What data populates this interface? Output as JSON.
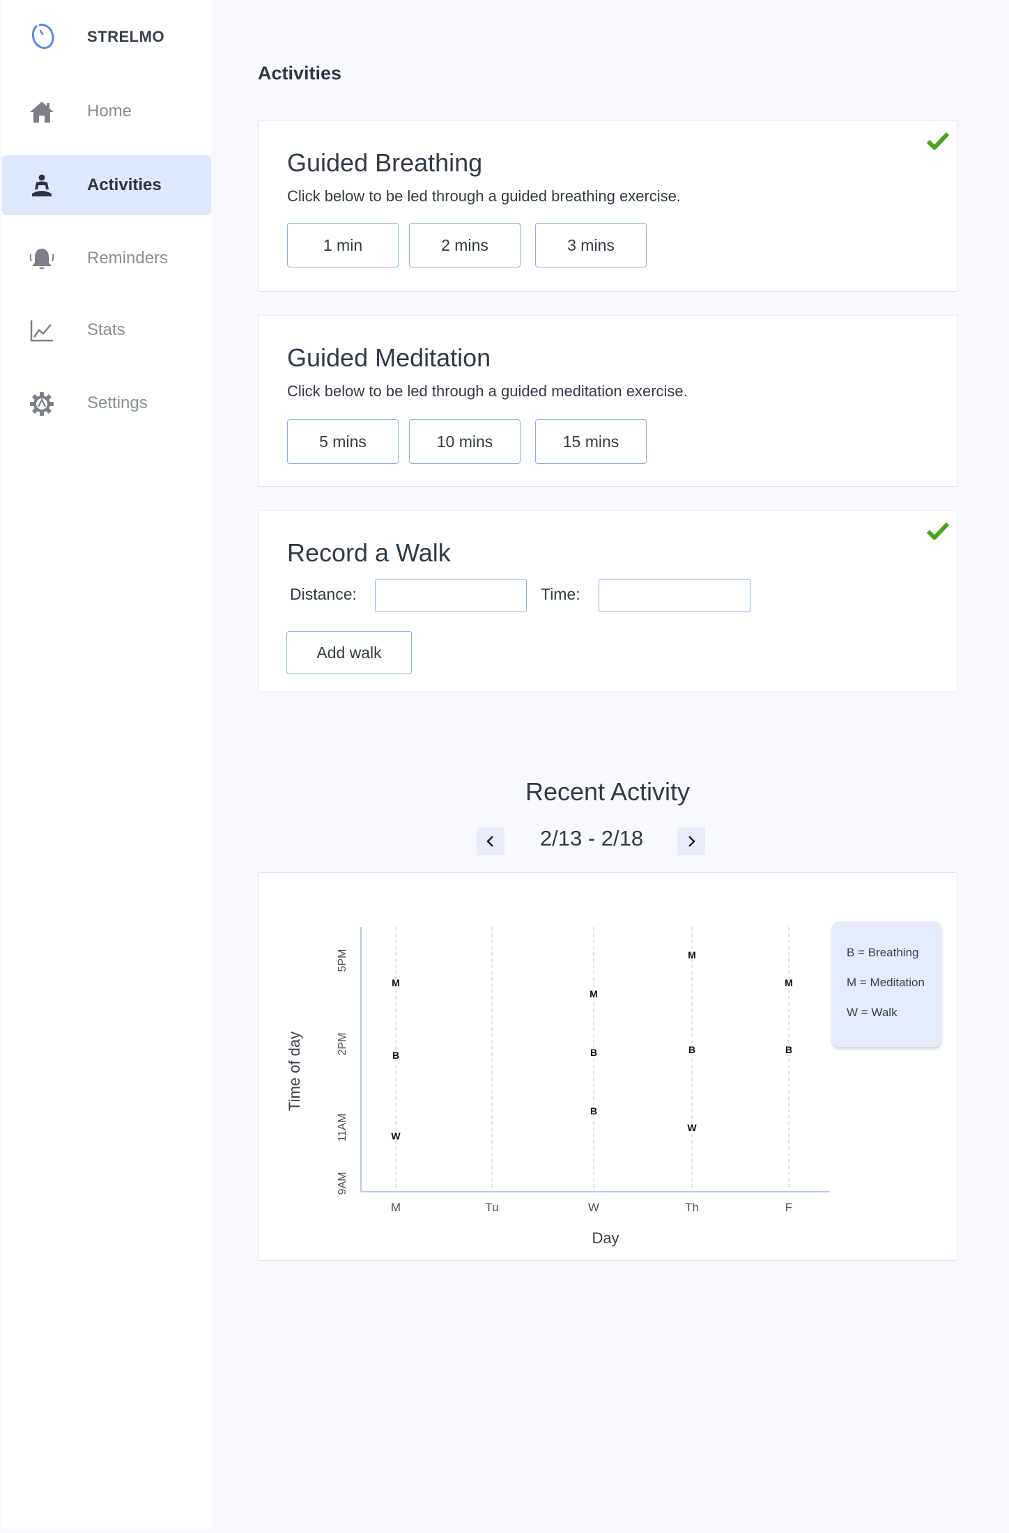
{
  "app": {
    "name": "STRELMO"
  },
  "sidebar": {
    "items": [
      {
        "label": "Home",
        "icon": "home-icon"
      },
      {
        "label": "Activities",
        "icon": "meditation-icon",
        "active": true
      },
      {
        "label": "Reminders",
        "icon": "bell-icon"
      },
      {
        "label": "Stats",
        "icon": "chart-line-icon"
      },
      {
        "label": "Settings",
        "icon": "gear-icon"
      }
    ]
  },
  "page": {
    "title": "Activities"
  },
  "breathing": {
    "title": "Guided Breathing",
    "description": "Click below to be led through a guided breathing exercise.",
    "options": [
      "1 min",
      "2 mins",
      "3 mins"
    ],
    "completed": true
  },
  "meditation": {
    "title": "Guided Meditation",
    "description": "Click below to be led through a guided meditation exercise.",
    "options": [
      "5 mins",
      "10 mins",
      "15 mins"
    ],
    "completed": false
  },
  "walk": {
    "title": "Record a Walk",
    "distance_label": "Distance:",
    "distance_value": "",
    "time_label": "Time:",
    "time_value": "",
    "add_label": "Add walk",
    "completed": true
  },
  "recent": {
    "title": "Recent Activity",
    "range": "2/13 - 2/18"
  },
  "colors": {
    "accent": "#5b87e0",
    "active_bg": "#dfe7fb",
    "check": "#4aa51e",
    "legend_bg": "#e5ebfa"
  },
  "chart_data": {
    "type": "scatter",
    "xlabel": "Day",
    "ylabel": "Time of day",
    "categories": [
      "M",
      "Tu",
      "W",
      "Th",
      "F"
    ],
    "y_ticks": [
      {
        "label": "9AM",
        "hour": 9
      },
      {
        "label": "11AM",
        "hour": 11
      },
      {
        "label": "2PM",
        "hour": 14
      },
      {
        "label": "5PM",
        "hour": 17
      }
    ],
    "ylim": [
      8.7,
      18.2
    ],
    "points": [
      {
        "day": "M",
        "hour": 16.2,
        "mark": "M"
      },
      {
        "day": "M",
        "hour": 13.6,
        "mark": "B"
      },
      {
        "day": "M",
        "hour": 10.7,
        "mark": "W"
      },
      {
        "day": "W",
        "hour": 15.8,
        "mark": "M"
      },
      {
        "day": "W",
        "hour": 13.7,
        "mark": "B"
      },
      {
        "day": "W",
        "hour": 11.6,
        "mark": "B"
      },
      {
        "day": "Th",
        "hour": 17.2,
        "mark": "M"
      },
      {
        "day": "Th",
        "hour": 13.8,
        "mark": "B"
      },
      {
        "day": "Th",
        "hour": 11.0,
        "mark": "W"
      },
      {
        "day": "F",
        "hour": 16.2,
        "mark": "M"
      },
      {
        "day": "F",
        "hour": 13.8,
        "mark": "B"
      }
    ],
    "legend": [
      "B = Breathing",
      "M = Meditation",
      "W = Walk"
    ],
    "legend_position": "right",
    "grid": "vertical dashed"
  }
}
